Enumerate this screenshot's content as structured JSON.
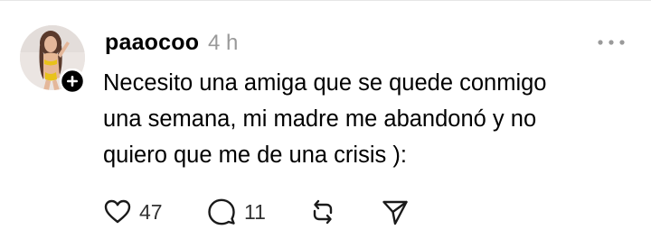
{
  "post": {
    "username": "paaocoo",
    "time": "4 h",
    "text": "Necesito una amiga que se quede conmigo\nuna semana, mi madre me abandonó y no\nquiero que me de una crisis ):",
    "avatar": {
      "description_icon": "profile-photo"
    }
  },
  "actions": {
    "like_count": "47",
    "reply_count": "11"
  },
  "icons": {
    "like": "heart-icon",
    "reply": "speech-bubble-icon",
    "repost": "repost-arrows-icon",
    "share": "send-paper-plane-icon",
    "more": "more-dots-icon",
    "follow": "plus-circle-icon"
  },
  "colors": {
    "text": "#000000",
    "muted": "#999999",
    "icon": "#1a1a1a",
    "divider": "#e6e6e6"
  }
}
